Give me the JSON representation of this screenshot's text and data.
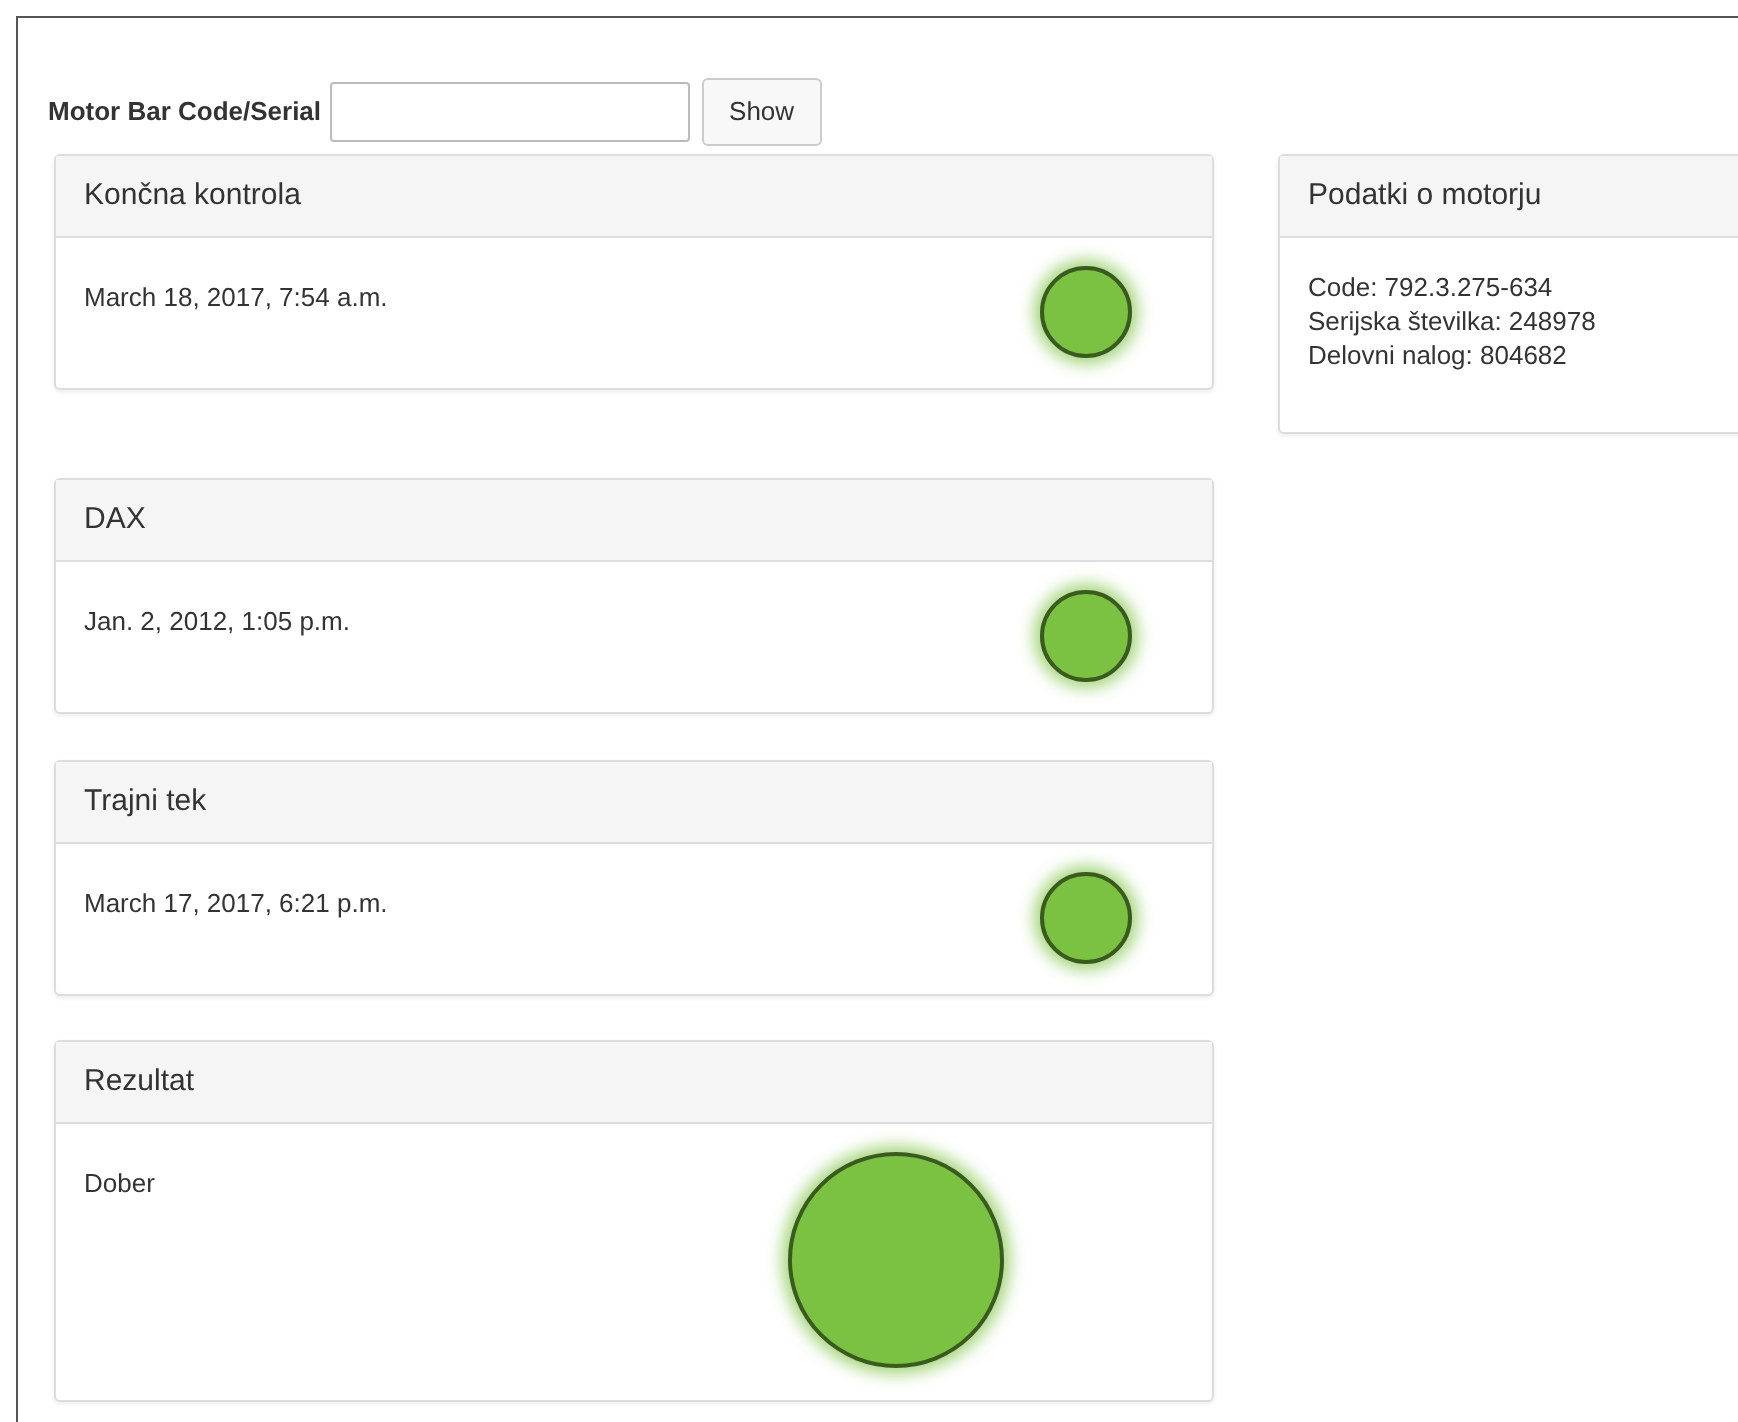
{
  "search": {
    "label": "Motor Bar Code/Serial",
    "button": "Show"
  },
  "panels": [
    {
      "kind": "status",
      "title": "Končna kontrola",
      "text": "March 18, 2017, 7:54 a.m.",
      "color": "#7cc242"
    },
    {
      "kind": "status",
      "title": "DAX",
      "text": "Jan. 2, 2012, 1:05 p.m.",
      "color": "#7cc242"
    },
    {
      "kind": "status",
      "title": "Trajni tek",
      "text": "March 17, 2017, 6:21 p.m.",
      "color": "#7cc242"
    },
    {
      "kind": "result",
      "title": "Rezultat",
      "text": "Dober",
      "color": "#7cc242"
    }
  ],
  "motor": {
    "title": "Podatki o motorju",
    "lines": [
      "Code: 792.3.275-634",
      "Serijska številka: 248978",
      "Delovni nalog: 804682"
    ]
  }
}
